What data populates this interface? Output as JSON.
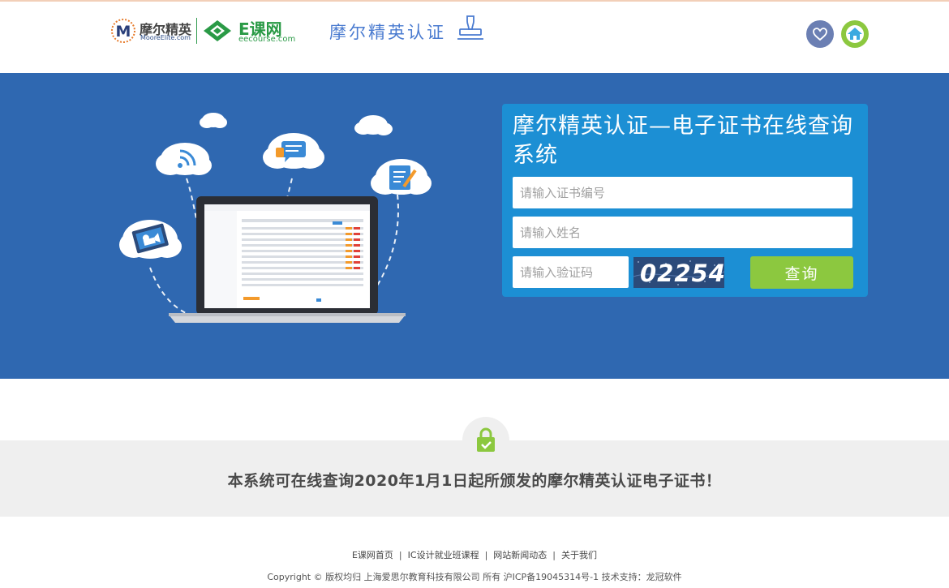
{
  "header": {
    "moore_logo": {
      "cn": "摩尔精英",
      "en": "MooreElite.com",
      "mark_letter": "M"
    },
    "ecourse_logo": {
      "cn": "E课网",
      "en": "eecourse.com"
    },
    "site_title": "摩尔精英认证",
    "icons": {
      "stamp": "stamp-icon",
      "favorite": "heart-icon",
      "home": "home-icon"
    }
  },
  "banner": {
    "background_color": "#2f68b1",
    "query_title": "摩尔精英认证—电子证书在线查询系统",
    "cert_placeholder": "请输入证书编号",
    "name_placeholder": "请输入姓名",
    "code_placeholder": "请输入验证码",
    "captcha": "02254",
    "query_button": "查询",
    "illustration_icons": [
      "wifi-icon",
      "chat-icon",
      "edit-icon",
      "video-icon",
      "laptop-icon"
    ]
  },
  "notice": {
    "text": "本系统可在线查询2020年1月1日起所颁发的摩尔精英认证电子证书！",
    "icon": "lock-check-icon"
  },
  "footer": {
    "links": [
      "E课网首页",
      "IC设计就业班课程",
      "网站新闻动态",
      "关于我们"
    ],
    "copyright": "Copyright © 版权均归 上海爱思尔教育科技有限公司 所有 沪ICP备19045314号-1 技术支持：龙冠软件"
  },
  "colors": {
    "accent_blue": "#1c8fd4",
    "accent_green": "#8cc83f",
    "title_blue": "#4a7bd0"
  }
}
